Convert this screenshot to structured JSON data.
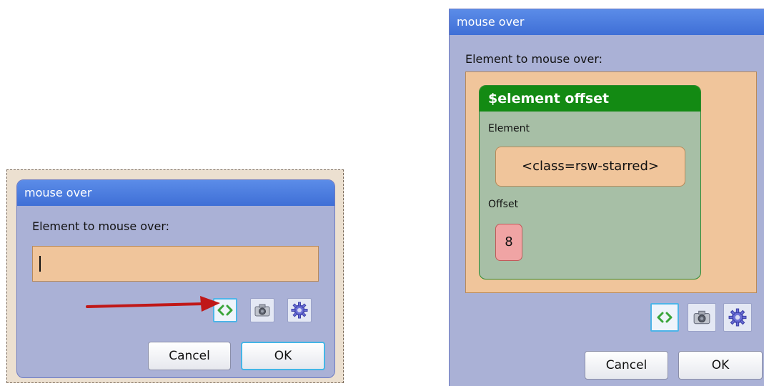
{
  "left_dialog": {
    "title": "mouse over",
    "prompt": "Element to mouse over:",
    "input_value": "",
    "buttons": {
      "cancel": "Cancel",
      "ok": "OK"
    }
  },
  "right_dialog": {
    "title": "mouse over",
    "prompt": "Element to mouse over:",
    "offset_block": {
      "title": "$element offset",
      "element_label": "Element",
      "element_value": "<class=rsw-starred>",
      "offset_label": "Offset",
      "offset_value": "8"
    },
    "buttons": {
      "cancel": "Cancel",
      "ok": "OK"
    }
  },
  "icons": [
    "code-brackets-icon",
    "camera-icon",
    "gear-icon"
  ],
  "colors": {
    "dialog_bg": "#aab1d6",
    "titlebar": "#4a7de0",
    "drop_target": "#f0c59b",
    "offset_block_header": "#138a13",
    "offset_block_bg": "#a7bfa6",
    "number_pill": "#f0a4a4",
    "arrow": "#c01818",
    "focus_ring": "#44b5e6"
  }
}
